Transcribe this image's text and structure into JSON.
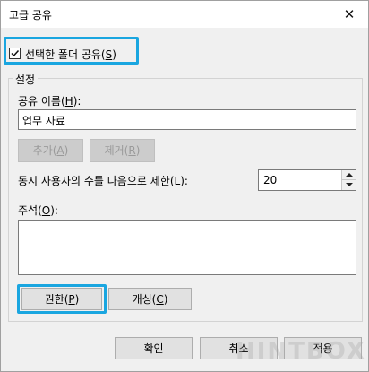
{
  "window": {
    "title": "고급 공유",
    "close_glyph": "✕"
  },
  "share_checkbox": {
    "label_prefix": "선택한 폴더 공유(",
    "label_key": "S",
    "label_suffix": ")",
    "checked": true
  },
  "settings": {
    "group_title": "설정",
    "share_name_prefix": "공유 이름(",
    "share_name_key": "H",
    "share_name_suffix": "):",
    "share_name_value": "업무 자료",
    "add_prefix": "추가(",
    "add_key": "A",
    "add_suffix": ")",
    "remove_prefix": "제거(",
    "remove_key": "R",
    "remove_suffix": ")",
    "limit_prefix": "동시 사용자의 수를 다음으로 제한(",
    "limit_key": "L",
    "limit_suffix": "):",
    "limit_value": "20",
    "comment_prefix": "주석(",
    "comment_key": "O",
    "comment_suffix": "):",
    "comment_value": "",
    "permissions_prefix": "권한(",
    "permissions_key": "P",
    "permissions_suffix": ")",
    "caching_prefix": "캐싱(",
    "caching_key": "C",
    "caching_suffix": ")"
  },
  "footer": {
    "ok": "확인",
    "cancel": "취소",
    "apply": "적용"
  },
  "watermark": "HINTBOX",
  "colors": {
    "highlight": "#1aa6e0",
    "dialog_bg": "#f0f0f0"
  }
}
